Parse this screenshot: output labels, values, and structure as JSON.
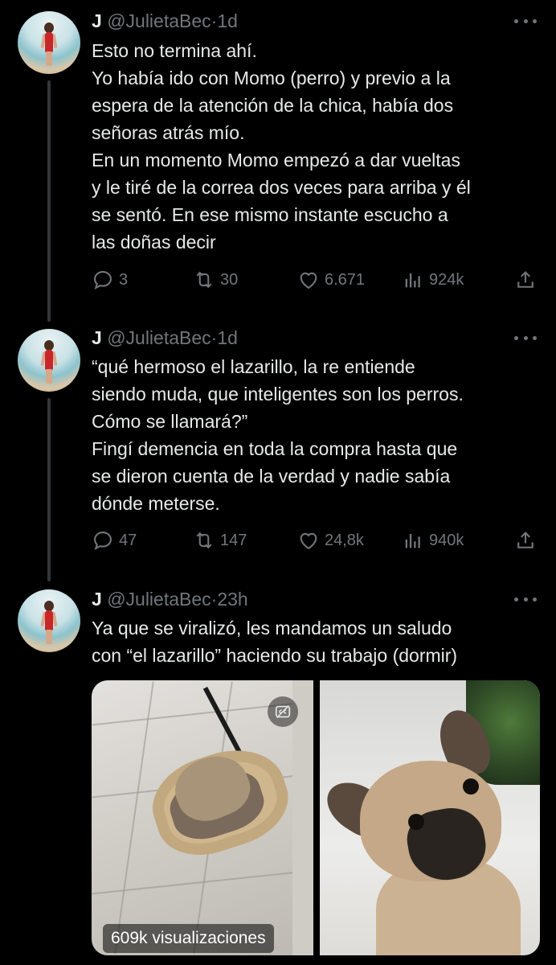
{
  "tweets": [
    {
      "name": "J",
      "handle": "@JulietaBec",
      "dot": "·",
      "time": "1d",
      "text": [
        "Esto no termina ahí.",
        "Yo había ido con Momo (perro) y previo a la",
        "espera de la atención de la chica, había dos",
        "señoras atrás mío.",
        "En un momento Momo empezó a dar vueltas",
        "y le tiré de la correa dos veces para arriba y él",
        "se sentó. En ese mismo instante escucho a",
        "las doñas decir"
      ],
      "replies": "3",
      "reposts": "30",
      "likes": "6.671",
      "views": "924k"
    },
    {
      "name": "J",
      "handle": "@JulietaBec",
      "dot": "·",
      "time": "1d",
      "text": [
        "“qué hermoso el lazarillo, la re entiende",
        "siendo muda, que inteligentes son los perros.",
        "Cómo se llamará?”",
        "Fingí demencia en toda la compra hasta que",
        "se dieron cuenta de la verdad y nadie sabía",
        "dónde meterse."
      ],
      "replies": "47",
      "reposts": "147",
      "likes": "24,8k",
      "views": "940k"
    },
    {
      "name": "J",
      "handle": "@JulietaBec",
      "dot": "·",
      "time": "23h",
      "text": [
        "Ya que se viralizó, les mandamos un saludo",
        "con “el lazarillo” haciendo su trabajo (dormir)"
      ],
      "media_views": "609k visualizaciones"
    }
  ],
  "icons": {
    "reply": "reply-icon",
    "repost": "repost-icon",
    "like": "heart-icon",
    "views": "analytics-icon",
    "share": "share-icon",
    "more": "more-icon",
    "alt": "cc-icon"
  },
  "colors": {
    "background": "#000000",
    "text": "#e7e9ea",
    "muted": "#71767b",
    "thread": "#333639"
  }
}
